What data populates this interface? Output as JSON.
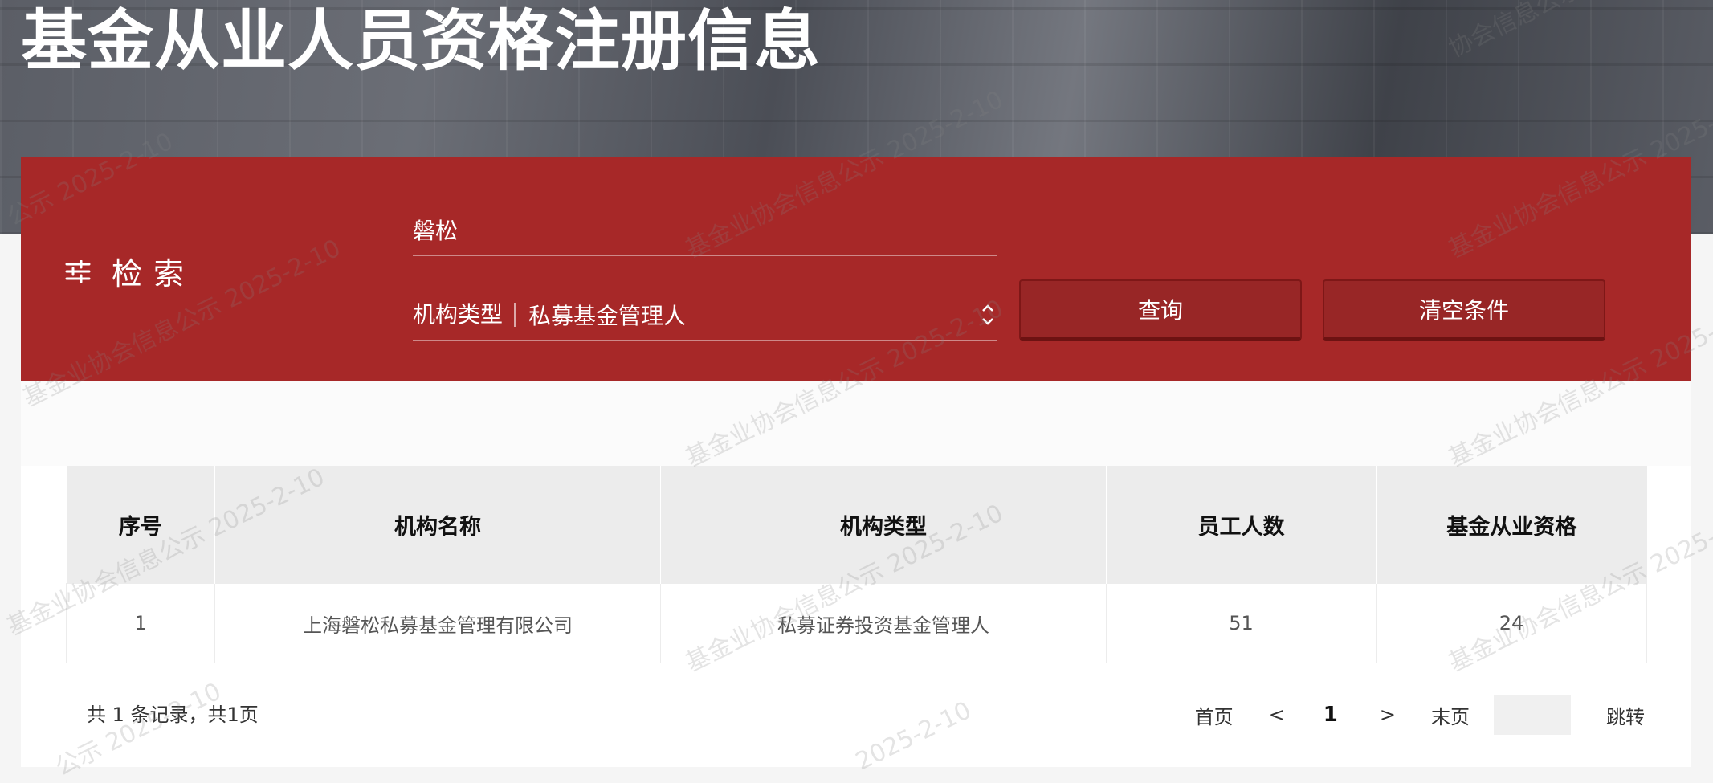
{
  "header": {
    "title": "基金从业人员资格注册信息"
  },
  "search": {
    "heading": "检索",
    "keyword_value": "磐松",
    "org_type_label": "机构类型",
    "org_type_value": "私募基金管理人",
    "query_button": "查询",
    "clear_button": "清空条件"
  },
  "table": {
    "columns": [
      "序号",
      "机构名称",
      "机构类型",
      "员工人数",
      "基金从业资格"
    ],
    "rows": [
      [
        "1",
        "上海磐松私募基金管理有限公司",
        "私募证券投资基金管理人",
        "51",
        "24"
      ]
    ]
  },
  "pagination": {
    "summary": "共 1 条记录，共1页",
    "first": "首页",
    "prev": "<",
    "current": "1",
    "next": ">",
    "last": "末页",
    "jump": "跳转"
  },
  "watermark": {
    "text": "基金业协会信息公示 2025-2-10",
    "text_b": "2025-2-10",
    "text_c": "公示 2025-2-10",
    "text_d": "协会信息公示 2025"
  },
  "colors": {
    "accent_red": "#a72828",
    "button_red": "#982626",
    "header_cell": "#ececec"
  }
}
